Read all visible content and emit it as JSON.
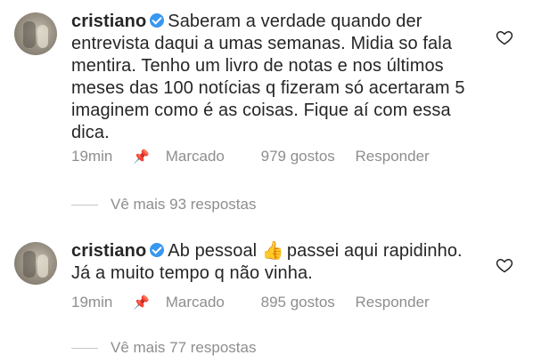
{
  "comments": [
    {
      "username": "cristiano",
      "text": "Saberam a verdade quando der entrevista daqui a umas semanas. Midia so fala mentira. Tenho um livro de notas e nos últimos meses das  100 notícias q fizeram só acertaram 5 imaginem como é as coisas. Fique aí com essa dica.",
      "time": "19min",
      "pinned_label": "Marcado",
      "likes": "979 gostos",
      "reply_label": "Responder",
      "view_replies": "Vê mais 93 respostas"
    },
    {
      "username": "cristiano",
      "text_before_emoji": "Ab pessoal",
      "emoji": "👍",
      "text_after_emoji": "passei aqui rapidinho. Já a muito tempo q não vinha.",
      "time": "19min",
      "pinned_label": "Marcado",
      "likes": "895 gostos",
      "reply_label": "Responder",
      "view_replies": "Vê mais 77 respostas"
    }
  ],
  "icons": {
    "heart": "heart-outline-icon",
    "pin": "pin-icon",
    "verified": "verified-badge-icon"
  },
  "colors": {
    "text": "#262626",
    "meta": "#8e8e8e",
    "verified": "#3897f0"
  }
}
